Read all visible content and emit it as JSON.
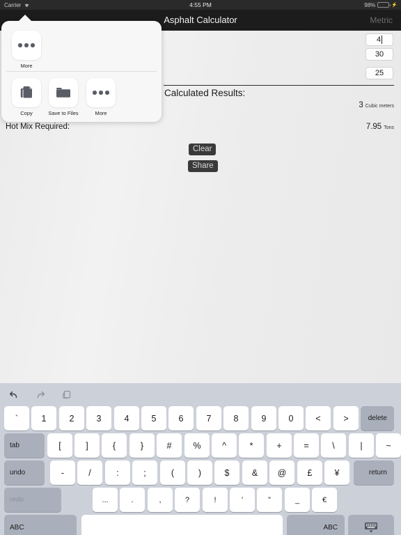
{
  "status_bar": {
    "carrier": "Carrier",
    "wifi_icon": "wifi-icon",
    "time": "4:55 PM",
    "battery_percent": "98%",
    "battery_level": 98,
    "charging_icon": "lightning-bolt-icon"
  },
  "nav_bar": {
    "title": "Asphalt Calculator",
    "right_button": "Metric"
  },
  "main": {
    "fields": [
      {
        "name": "length-field",
        "value": "4",
        "focused": true
      },
      {
        "name": "width-field",
        "value": "30",
        "focused": false
      },
      {
        "name": "depth-field",
        "value": "25",
        "focused": false
      }
    ],
    "results_heading": "Calculated Results:",
    "results": [
      {
        "label": "",
        "value": "3",
        "unit": "Cubic meters"
      },
      {
        "label": "Hot Mix Required:",
        "value": "7.95",
        "unit": "Tons"
      }
    ],
    "hot_mix_label": "Hot Mix Required:",
    "buttons": {
      "clear": "Clear",
      "share": "Share"
    }
  },
  "share_popover": {
    "top_section": [
      {
        "label": "More",
        "icon": "ellipsis-icon"
      }
    ],
    "actions": [
      {
        "label": "Copy",
        "icon": "copy-icon"
      },
      {
        "label": "Save to Files",
        "icon": "folder-icon"
      },
      {
        "label": "More",
        "icon": "ellipsis-icon"
      }
    ]
  },
  "keyboard": {
    "toolbar": [
      {
        "name": "undo-icon",
        "label": "undo"
      },
      {
        "name": "redo-icon",
        "label": "redo"
      },
      {
        "name": "paste-icon",
        "label": "paste"
      }
    ],
    "row1": [
      "`",
      "1",
      "2",
      "3",
      "4",
      "5",
      "6",
      "7",
      "8",
      "9",
      "0",
      "<",
      ">"
    ],
    "row1_action": "delete",
    "row2_action_left": "tab",
    "row2": [
      "[",
      "]",
      "{",
      "}",
      "#",
      "%",
      "^",
      "*",
      "+",
      "=",
      "\\",
      "|",
      "~"
    ],
    "row3_action_left": "undo",
    "row3": [
      "-",
      "/",
      ":",
      ";",
      "(",
      ")",
      "$",
      "&",
      "@",
      "£",
      "¥"
    ],
    "row3_action_right": "return",
    "row4_action_left": "redo",
    "row4": [
      "...",
      ".",
      ",",
      "?",
      "!",
      "’",
      "”",
      "_",
      "€"
    ],
    "row5_left": "ABC",
    "row5_space": "",
    "row5_right": "ABC",
    "row5_dismiss_icon": "hide-keyboard-icon"
  },
  "colors": {
    "status_bar_bg": "#2a2a2a",
    "nav_bar_bg": "#1c1c1c",
    "content_bg": "#ececec",
    "keyboard_bg": "#ccd0d9",
    "key_bg": "#ffffff",
    "key_dark_bg": "#aab0bb",
    "button_bg": "#3a3a3a",
    "battery_green": "#4cd964"
  }
}
